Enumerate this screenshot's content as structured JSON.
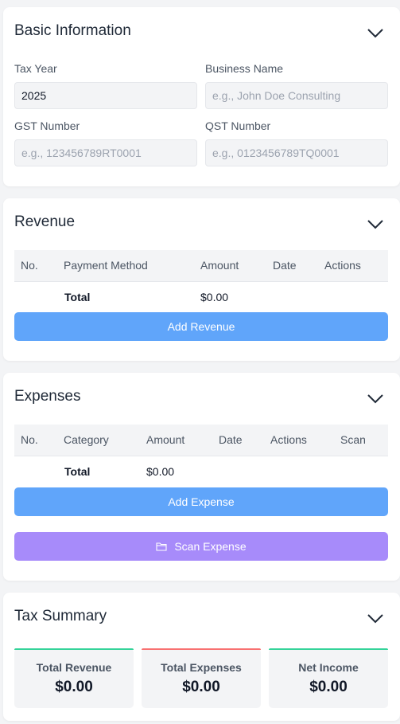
{
  "basic": {
    "title": "Basic Information",
    "tax_year_label": "Tax Year",
    "tax_year_value": "2025",
    "business_name_label": "Business Name",
    "business_name_placeholder": "e.g., John Doe Consulting",
    "gst_label": "GST Number",
    "gst_placeholder": "e.g., 123456789RT0001",
    "qst_label": "QST Number",
    "qst_placeholder": "e.g., 0123456789TQ0001"
  },
  "revenue": {
    "title": "Revenue",
    "columns": [
      "No.",
      "Payment Method",
      "Amount",
      "Date",
      "Actions"
    ],
    "total_label": "Total",
    "total_amount": "$0.00",
    "add_button": "Add Revenue"
  },
  "expenses": {
    "title": "Expenses",
    "columns": [
      "No.",
      "Category",
      "Amount",
      "Date",
      "Actions",
      "Scan"
    ],
    "total_label": "Total",
    "total_amount": "$0.00",
    "add_button": "Add Expense",
    "scan_button": "Scan Expense",
    "scan_icon": "folder-icon"
  },
  "summary": {
    "title": "Tax Summary",
    "items": [
      {
        "label": "Total Revenue",
        "value": "$0.00",
        "color": "#34d399"
      },
      {
        "label": "Total Expenses",
        "value": "$0.00",
        "color": "#f87171"
      },
      {
        "label": "Net Income",
        "value": "$0.00",
        "color": "#34d399"
      }
    ]
  },
  "colors": {
    "primary_button": "#60a5fa",
    "scan_button": "#a78bfa"
  }
}
